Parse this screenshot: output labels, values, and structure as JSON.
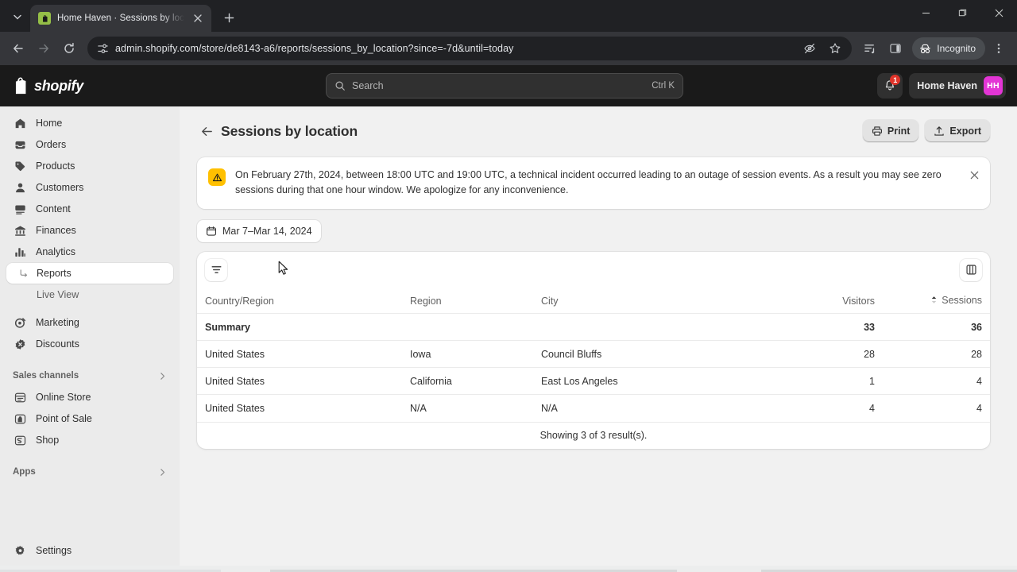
{
  "browser": {
    "tab": {
      "title": "Home Haven · Sessions by locat",
      "favicon": "shopify-bag-icon"
    },
    "url": "admin.shopify.com/store/de8143-a6/reports/sessions_by_location?since=-7d&until=today",
    "incognito_label": "Incognito",
    "icons": {
      "tab_search": "chevron-down-icon",
      "close_tab": "close-icon",
      "new_tab": "plus-icon",
      "back": "back-arrow-icon",
      "forward": "forward-arrow-icon",
      "reload": "reload-icon",
      "site_info": "site-settings-icon",
      "tracking_protection": "eye-slash-icon",
      "bookmark": "star-icon",
      "reading_list": "reading-list-icon",
      "side_panel": "side-panel-icon",
      "incognito": "incognito-hat-icon",
      "menu": "three-dot-menu-icon",
      "minimize": "minimize-icon",
      "maximize": "maximize-icon",
      "close_window": "window-close-icon"
    }
  },
  "topbar": {
    "brand": "shopify",
    "search": {
      "placeholder": "Search",
      "shortcut": "Ctrl K",
      "icon": "search-icon"
    },
    "notifications": {
      "icon": "bell-icon",
      "badge": "1"
    },
    "store": {
      "name": "Home Haven",
      "initials": "HH",
      "avatar_color": "#e335d5"
    }
  },
  "sidebar": {
    "items": [
      {
        "label": "Home",
        "icon": "home-icon"
      },
      {
        "label": "Orders",
        "icon": "orders-inbox-icon"
      },
      {
        "label": "Products",
        "icon": "product-tag-icon"
      },
      {
        "label": "Customers",
        "icon": "person-icon"
      },
      {
        "label": "Content",
        "icon": "content-icon"
      },
      {
        "label": "Finances",
        "icon": "bank-icon"
      },
      {
        "label": "Analytics",
        "icon": "bar-chart-icon"
      }
    ],
    "analytics_children": [
      {
        "label": "Reports",
        "active": true
      },
      {
        "label": "Live View",
        "active": false
      }
    ],
    "items_lower": [
      {
        "label": "Marketing",
        "icon": "marketing-target-icon"
      },
      {
        "label": "Discounts",
        "icon": "discount-badge-icon"
      }
    ],
    "sales_channels": {
      "label": "Sales channels",
      "chevron": "chevron-right-icon",
      "items": [
        {
          "label": "Online Store",
          "icon": "online-store-icon"
        },
        {
          "label": "Point of Sale",
          "icon": "point-of-sale-icon"
        },
        {
          "label": "Shop",
          "icon": "shop-icon"
        }
      ]
    },
    "apps": {
      "label": "Apps",
      "chevron": "chevron-right-icon"
    },
    "settings": {
      "label": "Settings",
      "icon": "gear-icon"
    }
  },
  "page": {
    "back_icon": "back-arrow-icon",
    "title": "Sessions by location",
    "actions": [
      {
        "label": "Print",
        "icon": "printer-icon"
      },
      {
        "label": "Export",
        "icon": "export-upload-icon"
      }
    ],
    "banner": {
      "icon": "warning-triangle-icon",
      "accent": "#ffc000",
      "text": "On February 27th, 2024, between 18:00 UTC and 19:00 UTC, a technical incident occurred leading to an outage of session events. As a result you may see zero sessions during that one hour window. We apologize for any inconvenience.",
      "close_icon": "close-icon"
    },
    "date_range": {
      "label": "Mar 7–Mar 14, 2024",
      "icon": "calendar-icon"
    },
    "table_toolbar": {
      "filter_icon": "filter-icon",
      "columns_icon": "columns-icon"
    },
    "table": {
      "columns": [
        "Country/Region",
        "Region",
        "City",
        "Visitors",
        "Sessions"
      ],
      "sorted_column": "Sessions",
      "sort_icon": "sort-caret-icon",
      "summary": {
        "label": "Summary",
        "visitors": "33",
        "sessions": "36"
      },
      "rows": [
        {
          "country": "United States",
          "region": "Iowa",
          "city": "Council Bluffs",
          "visitors": "28",
          "sessions": "28"
        },
        {
          "country": "United States",
          "region": "California",
          "city": "East Los Angeles",
          "visitors": "1",
          "sessions": "4"
        },
        {
          "country": "United States",
          "region": "N/A",
          "city": "N/A",
          "visitors": "4",
          "sessions": "4"
        }
      ],
      "footer": "Showing 3 of 3 result(s)."
    }
  }
}
